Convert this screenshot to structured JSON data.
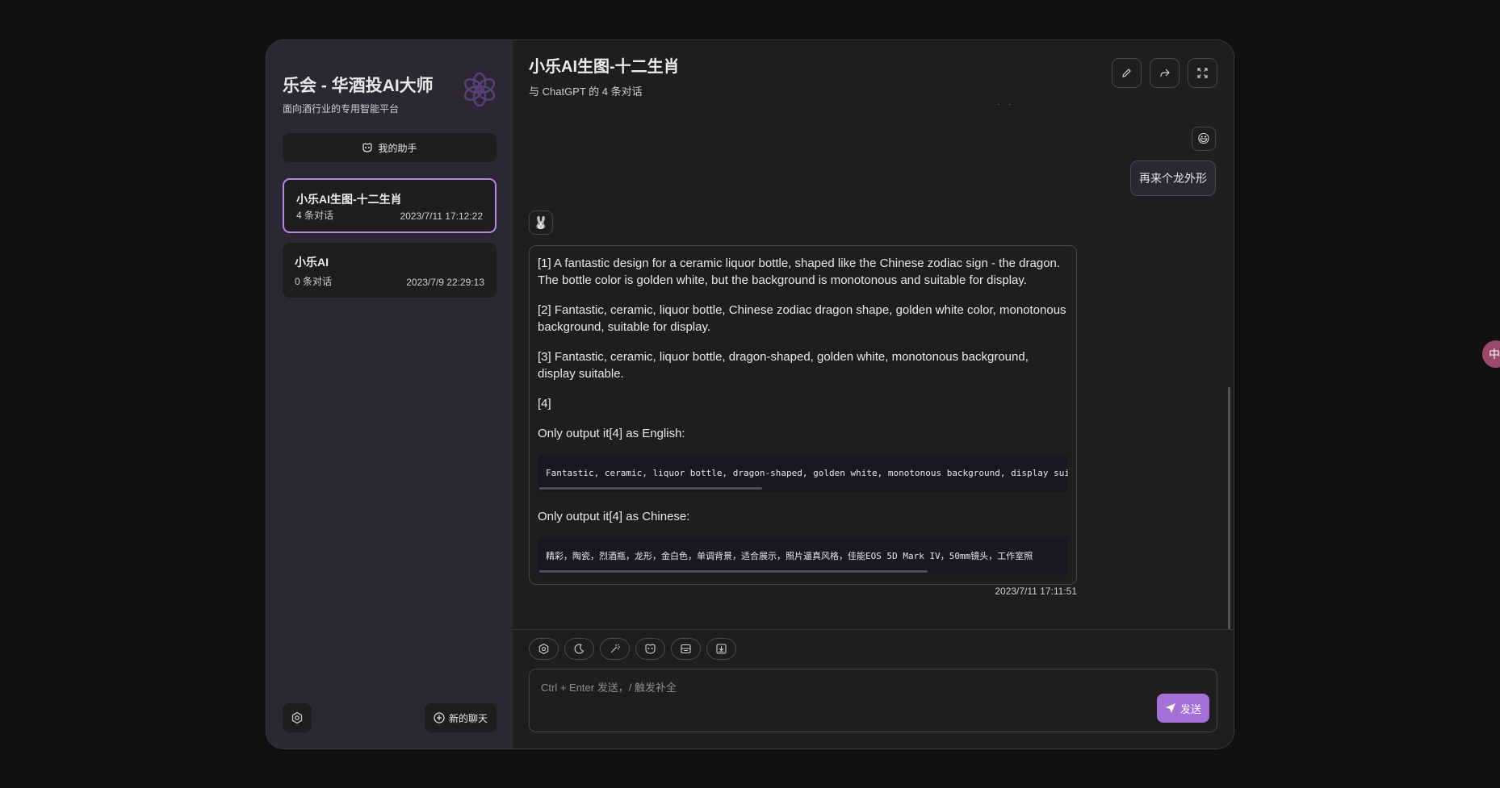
{
  "sidebar": {
    "title": "乐会 - 华酒投AI大师",
    "subtitle": "面向酒行业的专用智能平台",
    "assistant_button": "我的助手",
    "chats": [
      {
        "title": "小乐AI生图-十二生肖",
        "count": "4 条对话",
        "date": "2023/7/11 17:12:22",
        "active": true
      },
      {
        "title": "小乐AI",
        "count": "0 条对话",
        "date": "2023/7/9 22:29:13",
        "active": false
      }
    ],
    "new_chat_label": "新的聊天"
  },
  "header": {
    "title": "小乐AI生图-十二生肖",
    "subtitle": "与 ChatGPT 的 4 条对话",
    "buttons": [
      "edit-icon",
      "share-icon",
      "fullscreen-icon"
    ]
  },
  "messages": {
    "user": {
      "avatar": "😃",
      "text": "再来个龙外形"
    },
    "bot": {
      "avatar": "🐰",
      "paragraphs": [
        "[1] A fantastic design for a ceramic liquor bottle, shaped like the Chinese zodiac sign - the dragon. The bottle color is golden white, but the background is monotonous and suitable for display.",
        "[2] Fantastic, ceramic, liquor bottle, Chinese zodiac dragon shape, golden white color, monotonous background, suitable for display.",
        "[3] Fantastic, ceramic, liquor bottle, dragon-shaped, golden white, monotonous background, display suitable.",
        "[4]"
      ],
      "english_label": "Only output it[4] as English:",
      "english_code": "Fantastic, ceramic, liquor bottle, dragon-shaped, golden white, monotonous background, display sui",
      "chinese_label": "Only output it[4] as Chinese:",
      "chinese_code": "精彩，陶瓷，烈酒瓶，龙形，金白色，单调背景，适合展示，照片逼真风格，佳能EOS 5D Mark IV，50mm镜头，工作室照",
      "time": "2023/7/11 17:11:51"
    }
  },
  "composer": {
    "tools": [
      "settings-icon",
      "moon-icon",
      "magic-wand-icon",
      "mask-icon",
      "template-icon",
      "export-icon"
    ],
    "placeholder": "Ctrl + Enter 发送，/ 触发补全",
    "send_label": "发送"
  },
  "floating_badge": "中",
  "colors": {
    "background": "#111111",
    "sidebar": "#2c2833",
    "panel": "#1e1e1e",
    "accent": "#a46fd6",
    "active_border": "#b985e0"
  }
}
